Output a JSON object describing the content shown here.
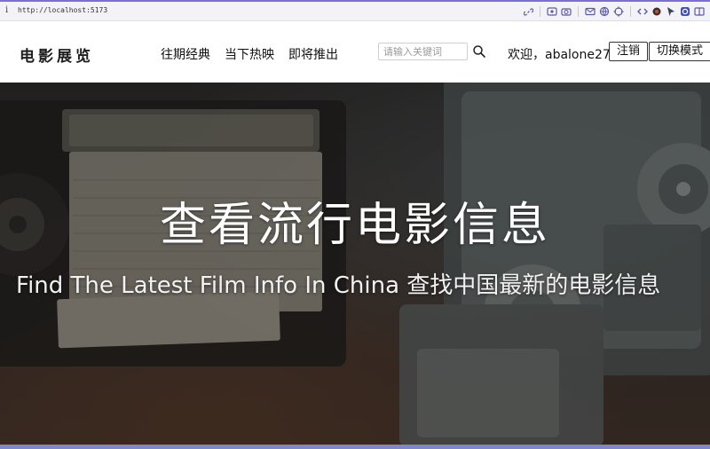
{
  "browser": {
    "url": "http://localhost:5173",
    "info_icon": "i",
    "toolbar_icons": [
      "link-icon",
      "screen-capture-icon",
      "camera-icon",
      "mail-icon",
      "globe-icon",
      "target-icon",
      "code-arrows-icon",
      "record-icon",
      "cursor-icon",
      "extension-icon",
      "sidebar-icon"
    ]
  },
  "nav": {
    "logo": "电影展览",
    "menu": [
      "往期经典",
      "当下热映",
      "即将推出"
    ],
    "search": {
      "placeholder": "请输入关键词",
      "value": ""
    },
    "welcome": "欢迎，abalone27",
    "logout_label": "注销",
    "mode_label": "切换模式"
  },
  "hero": {
    "title": "查看流行电影信息",
    "subtitle": "Find The Latest Film Info In China 查找中国最新的电影信息"
  },
  "colors": {
    "accent_strip": "#7f86c9",
    "browser_top": "#7b6fd1"
  }
}
